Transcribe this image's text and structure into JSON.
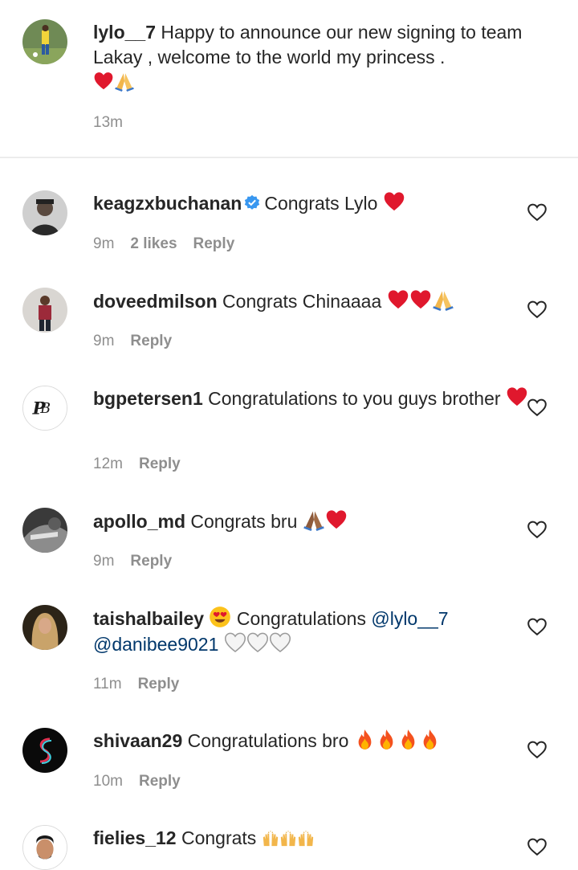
{
  "caption": {
    "username": "lylo__7",
    "text": "Happy to announce our new signing to team Lakay , welcome to the world my princess .",
    "time": "13m"
  },
  "comments": [
    {
      "username": "keagzxbuchanan",
      "text": "Congrats Lylo",
      "time": "9m",
      "likes": "2 likes",
      "reply": "Reply"
    },
    {
      "username": "doveedmilson",
      "text": "Congrats Chinaaaa",
      "time": "9m",
      "reply": "Reply"
    },
    {
      "username": "bgpetersen1",
      "text": "Congratulations to you guys brother",
      "time": "12m",
      "reply": "Reply"
    },
    {
      "username": "apollo_md",
      "text": "Congrats bru",
      "time": "9m",
      "reply": "Reply"
    },
    {
      "username": "taishalbailey",
      "text": "Congratulations",
      "mention1": "@lylo__7",
      "mention2": "@danibee9021",
      "time": "11m",
      "reply": "Reply"
    },
    {
      "username": "shivaan29",
      "text": "Congratulations bro",
      "time": "10m",
      "reply": "Reply"
    },
    {
      "username": "fielies_12",
      "text": "Congrats"
    }
  ],
  "icons": {
    "like": "heart-outline-icon",
    "verified": "verified-badge-icon",
    "emoji_heart": "red-heart-emoji",
    "emoji_pray": "folded-hands-emoji",
    "emoji_heart_eyes": "heart-eyes-emoji",
    "emoji_white_heart": "white-heart-emoji",
    "emoji_fire": "fire-emoji",
    "emoji_raised_hands": "raised-hands-emoji"
  },
  "colors": {
    "text": "#262626",
    "meta": "#8e8e8e",
    "mention": "#00376b",
    "verified": "#3897f0",
    "heart_emoji": "#e0182d"
  }
}
